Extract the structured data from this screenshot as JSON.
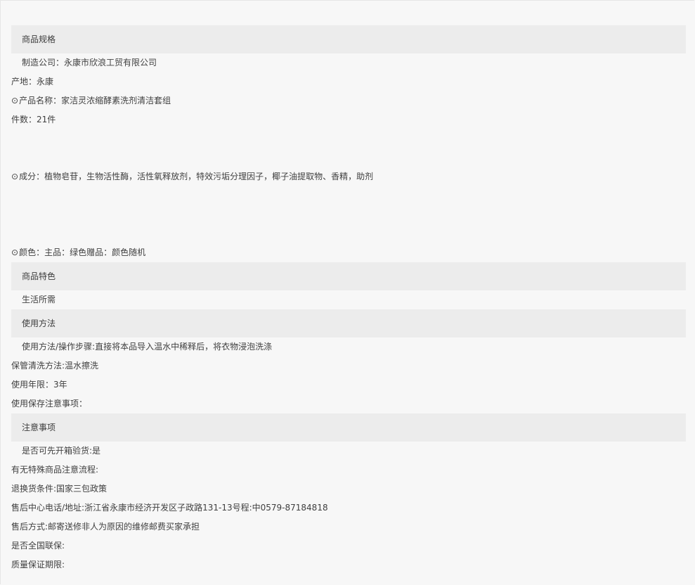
{
  "sections": {
    "specs": {
      "title": "商品规格",
      "manufacturer": "制造公司：永康市欣浪工贸有限公司",
      "origin": "产地：永康",
      "product_name": "产品名称：家洁灵浓缩酵素洗剂清洁套组",
      "pieces": "件数：21件",
      "ingredients": "成分：植物皂苷，生物活性酶，活性氧释放剂，特效污垢分理因子，椰子油提取物、香精，助剂",
      "color": "颜色：主品：绿色赠品：颜色随机",
      "bullet": "⊙"
    },
    "features": {
      "title": "商品特色",
      "text": "生活所需"
    },
    "usage": {
      "title": "使用方法",
      "steps": "使用方法/操作步骤:直接将本品导入温水中稀释后，将衣物浸泡洗涤",
      "care": "保管清洗方法:温水擦洗",
      "years": "使用年限：3年",
      "notes": "使用保存注意事项："
    },
    "notices": {
      "title": "注意事项",
      "inspect": "是否可先开箱验货:是",
      "special": "有无特殊商品注意流程:",
      "return": "退换货条件:国家三包政策",
      "service_center": "售后中心电话/地址:浙江省永康市经济开发区子政路131-13号程:中0579-87184818",
      "service_method": "售后方式:邮寄送修非人为原因的维修邮费买家承担",
      "national_warranty": "是否全国联保:",
      "warranty_period": "质量保证期限:"
    }
  }
}
